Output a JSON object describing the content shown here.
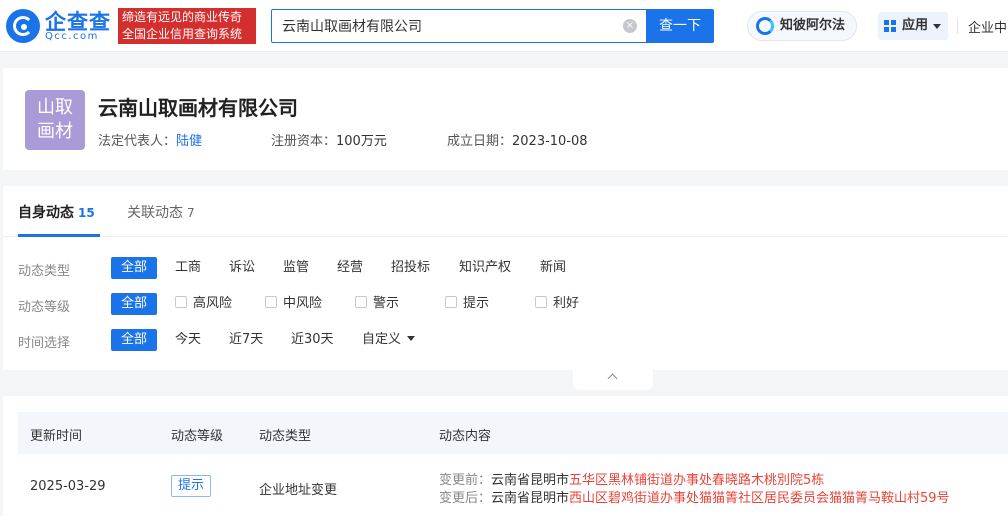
{
  "header": {
    "brand_name": "企查查",
    "brand_sub": "Qcc.com",
    "slogan_line1": "缔造有远见的商业传奇",
    "slogan_line2": "全国企业信用查询系统",
    "search_value": "云南山取画材有限公司",
    "search_clear": "×",
    "search_button": "查一下",
    "zhibi_label": "知彼阿尔法",
    "apps_label": "应用",
    "enterprise_label": "企业中"
  },
  "company": {
    "logo_line1": "山取",
    "logo_line2": "画材",
    "name": "云南山取画材有限公司",
    "legal_rep_label": "法定代表人：",
    "legal_rep_value": "陆健",
    "capital_label": "注册资本：",
    "capital_value": "100万元",
    "founded_label": "成立日期：",
    "founded_value": "2023-10-08"
  },
  "tabs": [
    {
      "label": "自身动态",
      "count": "15"
    },
    {
      "label": "关联动态",
      "count": "7"
    }
  ],
  "filters": {
    "type": {
      "label": "动态类型",
      "options": [
        "全部",
        "工商",
        "诉讼",
        "监管",
        "经营",
        "招投标",
        "知识产权",
        "新闻"
      ]
    },
    "level": {
      "label": "动态等级",
      "options": [
        "全部",
        "高风险",
        "中风险",
        "警示",
        "提示",
        "利好"
      ]
    },
    "time": {
      "label": "时间选择",
      "options": [
        "全部",
        "今天",
        "近7天",
        "近30天",
        "自定义"
      ]
    }
  },
  "table": {
    "headers": [
      "更新时间",
      "动态等级",
      "动态类型",
      "动态内容"
    ],
    "rows": [
      {
        "date": "2025-03-29",
        "level": "提示",
        "type": "企业地址变更",
        "before_label": "变更前：",
        "before_plain": "云南省昆明市",
        "before_highlight": "五华区黑林铺街道办事处春晓路木桃別院5栋",
        "after_label": "变更后：",
        "after_plain": "云南省昆明市",
        "after_highlight": "西山区碧鸡街道办事处猫猫箐社区居民委员会猫猫箐马鞍山村59号"
      }
    ]
  },
  "colors": {
    "accent": "#1a73e8",
    "slogan_bg": "#d32f2f",
    "highlight": "#e8443a",
    "company_logo_bg": "#a99ad8"
  }
}
